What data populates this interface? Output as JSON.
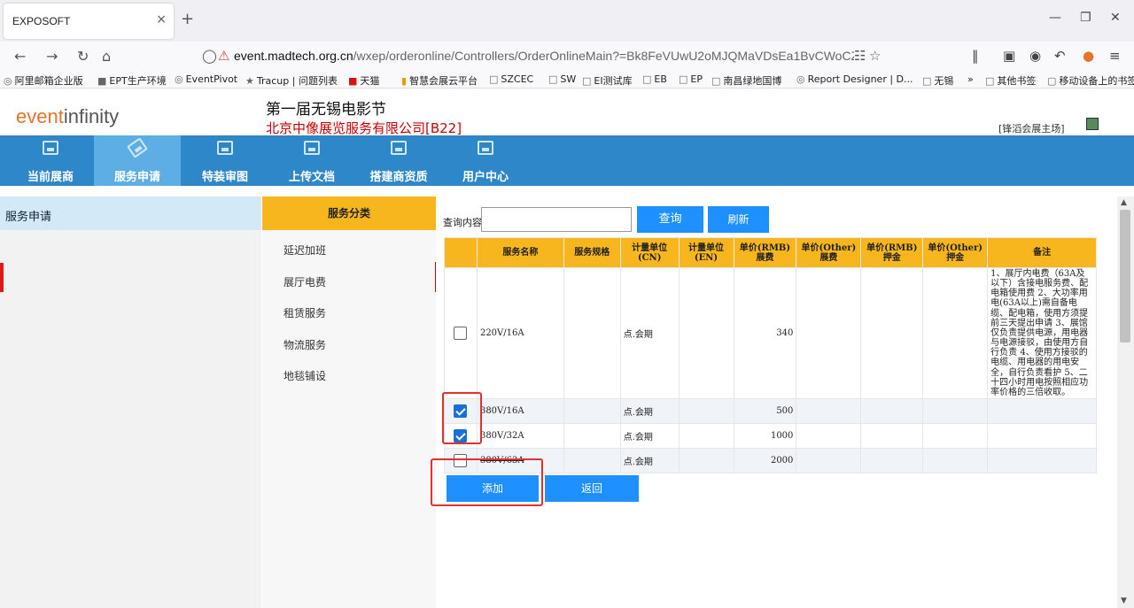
{
  "browser": {
    "tab_title": "EXPOSOFT",
    "tab_close": "×",
    "new_tab": "+",
    "url_domain": "event.madtech.org.cn",
    "url_path": "/wxep/orderonline/Controllers/OrderOnlineMain?=Bk8FeVUwU2oMJQMaVDsEa1BvCWoCZFNNAz5Z",
    "bookmarks": [
      "阿里邮箱企业版",
      "EPT生产环境",
      "EventPivot",
      "Tracup | 问题列表",
      "天猫",
      "智慧会展云平台",
      "SZCEC",
      "SW",
      "EI测试库",
      "EB",
      "EP",
      "南昌绿地国博",
      "Report Designer | D...",
      "无锡",
      "其他书签",
      "移动设备上的书签"
    ]
  },
  "header": {
    "logo_prefix": "event",
    "logo_suffix": "infinity",
    "event_title": "第一届无锡电影节",
    "company": "北京中像展览服务有限公司[B22]",
    "venue": "[锋滔会展主场]"
  },
  "main_nav": [
    {
      "label": "当前展商",
      "active": false
    },
    {
      "label": "服务申请",
      "active": true
    },
    {
      "label": "特装审图",
      "active": false
    },
    {
      "label": "上传文档",
      "active": false
    },
    {
      "label": "搭建商资质",
      "active": false
    },
    {
      "label": "用户中心",
      "active": false
    }
  ],
  "sidebar": {
    "title": "服务申请"
  },
  "categories": {
    "header": "服务分类",
    "items": [
      "延迟加班",
      "展厅电费",
      "租赁服务",
      "物流服务",
      "地毯铺设"
    ],
    "selected": "展厅电费"
  },
  "search": {
    "label": "查询内容",
    "value": "",
    "search_button": "查询",
    "refresh_button": "刷新"
  },
  "table": {
    "headers": [
      "服务名称",
      "服务规格",
      "计量单位 (CN)",
      "计量单位 (EN)",
      "单价(RMB) 展费",
      "单价(Other) 展费",
      "单价(RMB) 押金",
      "单价(Other) 押金",
      "备注"
    ],
    "rows": [
      {
        "checked": false,
        "name": "220V/16A",
        "spec": "",
        "unit_cn": "点.会期",
        "unit_en": "",
        "price_rmb": "340",
        "price_other": "",
        "deposit_rmb": "",
        "deposit_other": "",
        "note": "1、展厅内电费（63A及以下）含接电服务费、配电箱使用费 2、大功率用电(63A以上)需自备电缆、配电箱，使用方须提前三天提出申请 3、展馆仅负责提供电源，用电器与电源接驳，由使用方自行负责 4、使用方接驳的电缆、用电器的用电安全，自行负责看护 5、二十四小时用电按照相应功率价格的三倍收取。"
      },
      {
        "checked": true,
        "name": "380V/16A",
        "spec": "",
        "unit_cn": "点.会期",
        "unit_en": "",
        "price_rmb": "500",
        "price_other": "",
        "deposit_rmb": "",
        "deposit_other": "",
        "note": ""
      },
      {
        "checked": true,
        "name": "380V/32A",
        "spec": "",
        "unit_cn": "点.会期",
        "unit_en": "",
        "price_rmb": "1000",
        "price_other": "",
        "deposit_rmb": "",
        "deposit_other": "",
        "note": ""
      },
      {
        "checked": false,
        "name": "380V/63A",
        "spec": "",
        "unit_cn": "点.会期",
        "unit_en": "",
        "price_rmb": "2000",
        "price_other": "",
        "deposit_rmb": "",
        "deposit_other": "",
        "note": ""
      }
    ]
  },
  "actions": {
    "add_button": "添加",
    "back_button": "返回"
  },
  "colors": {
    "nav_blue": "#2d87c8",
    "nav_active": "#5eaee6",
    "accent_orange": "#f8b61e",
    "button_blue": "#1e90ff",
    "highlight_red": "#e23030"
  }
}
